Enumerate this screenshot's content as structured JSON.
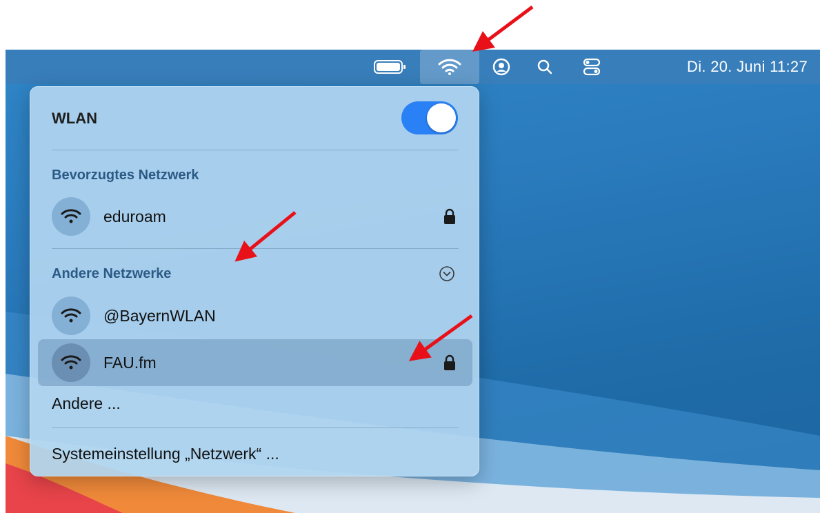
{
  "menubar": {
    "clock": "Di. 20. Juni 11:27",
    "icons": [
      "battery-icon",
      "wifi-icon",
      "user-circle-icon",
      "search-icon",
      "control-center-icon"
    ]
  },
  "wifi_menu": {
    "title": "WLAN",
    "toggle_on": true,
    "preferred_section": "Bevorzugtes Netzwerk",
    "preferred_networks": [
      {
        "name": "eduroam",
        "locked": true
      }
    ],
    "other_section": "Andere Netzwerke",
    "other_networks": [
      {
        "name": "@BayernWLAN",
        "locked": false
      },
      {
        "name": "FAU.fm",
        "locked": true,
        "highlighted": true
      }
    ],
    "other_link": "Andere ...",
    "settings_link": "Systemeinstellung „Netzwerk“ ..."
  },
  "colors": {
    "toggle_accent": "#2a80f5",
    "arrow": "#e8111a",
    "section_text": "#2c5a85"
  }
}
